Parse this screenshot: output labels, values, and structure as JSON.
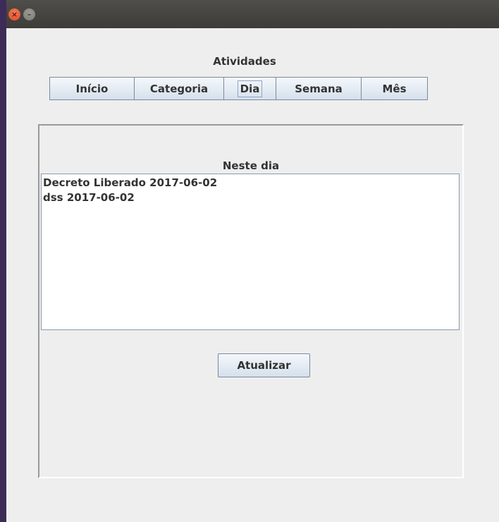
{
  "window": {
    "close_glyph": "×",
    "minimize_glyph": "–"
  },
  "header": {
    "title": "Atividades"
  },
  "tabs": [
    {
      "label": "Início"
    },
    {
      "label": "Categoria"
    },
    {
      "label": "Dia",
      "selected": true
    },
    {
      "label": "Semana"
    },
    {
      "label": "Mês"
    }
  ],
  "panel": {
    "title": "Neste dia",
    "items": [
      "Decreto Liberado 2017-06-02",
      "dss 2017-06-02"
    ],
    "update_label": "Atualizar"
  }
}
